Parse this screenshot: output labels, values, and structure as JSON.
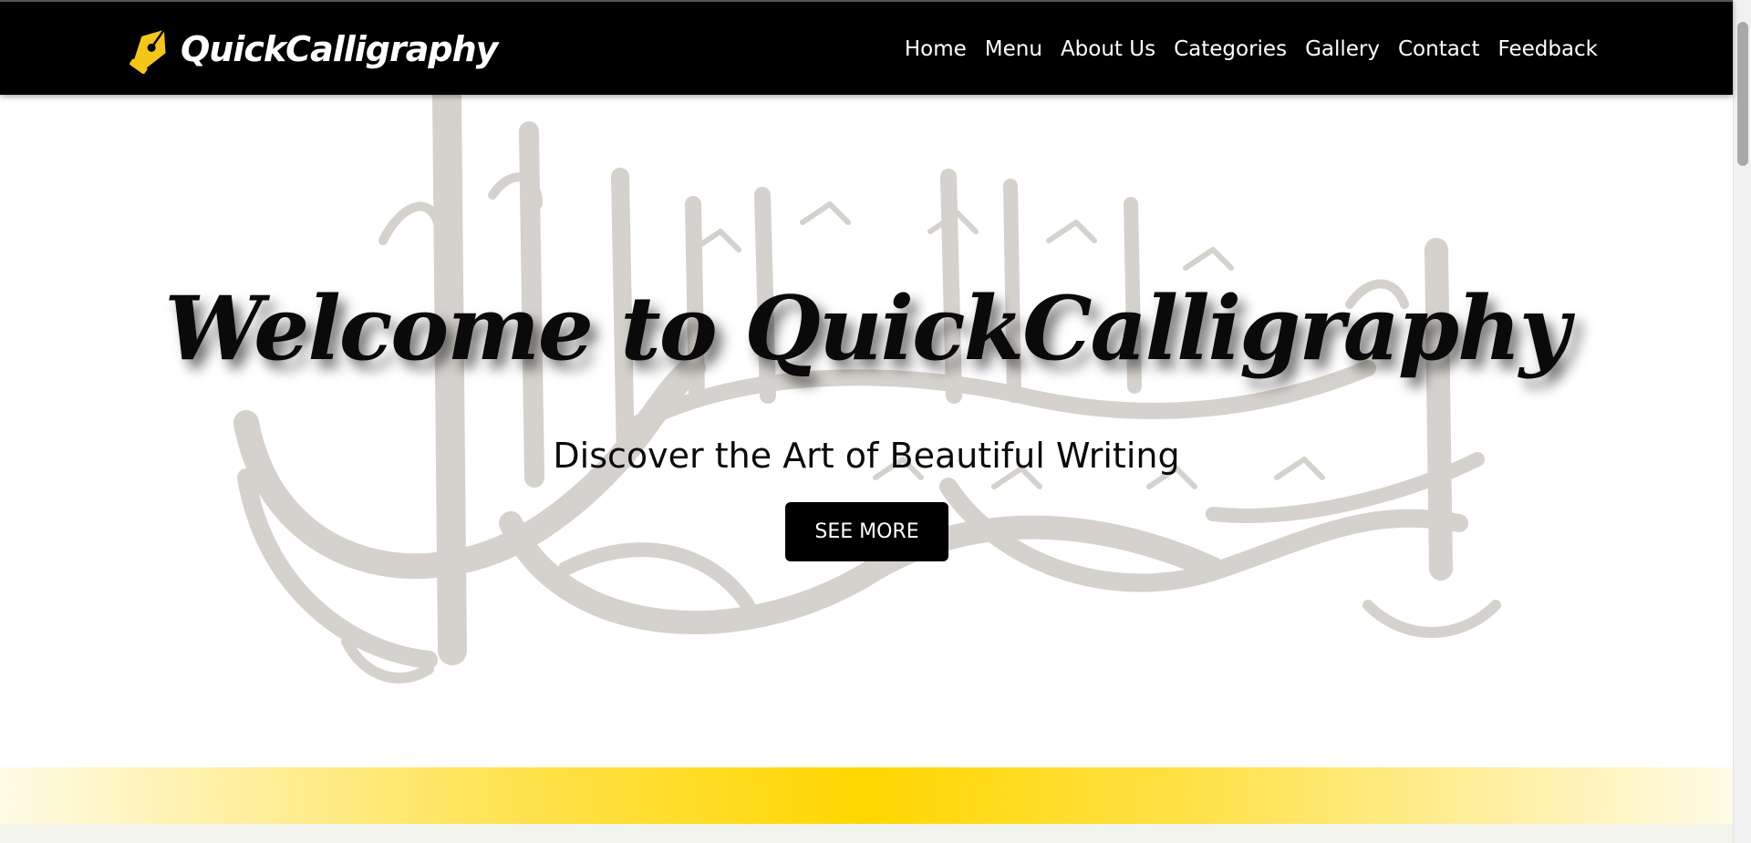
{
  "brand": {
    "name": "QuickCalligraphy",
    "icon": "pen-nib-icon",
    "icon_color": "#f5c518"
  },
  "nav": {
    "items": [
      {
        "label": "Home"
      },
      {
        "label": "Menu"
      },
      {
        "label": "About Us"
      },
      {
        "label": "Categories"
      },
      {
        "label": "Gallery"
      },
      {
        "label": "Contact"
      },
      {
        "label": "Feedback"
      }
    ]
  },
  "hero": {
    "title": "Welcome to QuickCalligraphy",
    "subtitle": "Discover the Art of Beautiful Writing",
    "button_label": "SEE MORE",
    "background_image": "arabic-calligraphy-watermark"
  },
  "colors": {
    "navbar_bg": "#000000",
    "accent_gold": "#ffd700",
    "button_bg": "#000000"
  }
}
